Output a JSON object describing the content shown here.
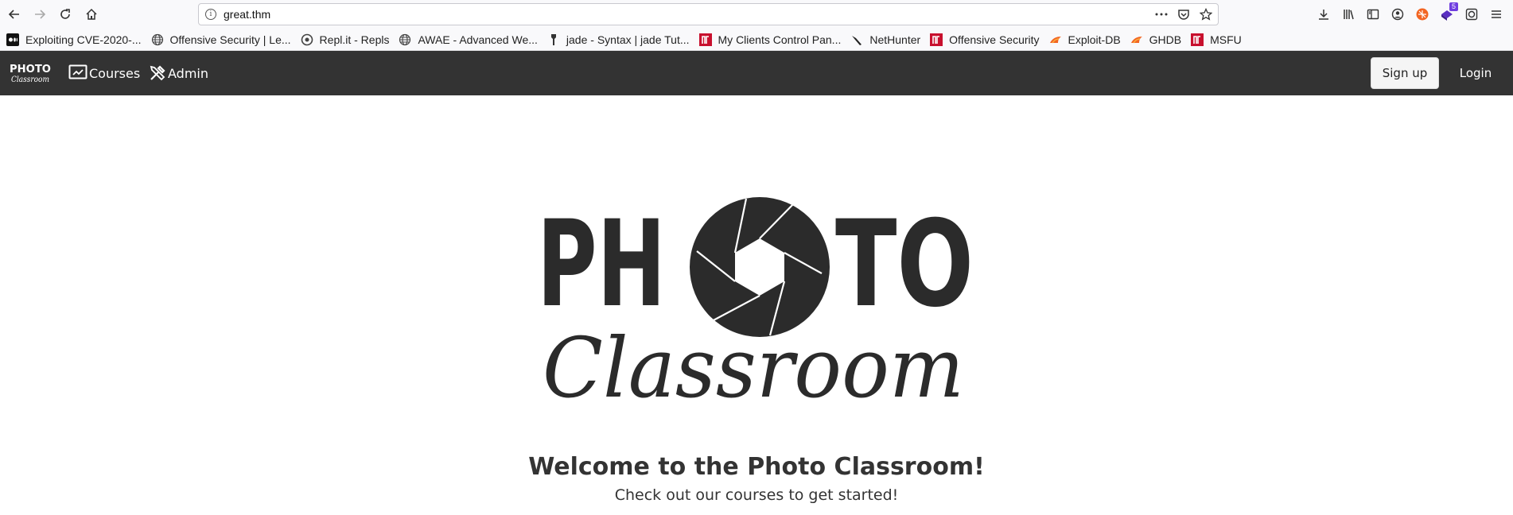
{
  "browser": {
    "url": "great.thm",
    "extension_badge": "5",
    "icons": [
      "back-icon",
      "forward-icon",
      "reload-icon",
      "home-icon",
      "info-icon",
      "more-icon",
      "pocket-icon",
      "bookmark-star-icon",
      "download-icon",
      "library-icon",
      "sidebar-icon",
      "account-icon",
      "extension-icon",
      "menu-icon"
    ]
  },
  "bookmarks": [
    {
      "label": "Exploiting CVE-2020-...",
      "icon": "medium-icon"
    },
    {
      "label": "Offensive Security | Le...",
      "icon": "globe-icon"
    },
    {
      "label": "Repl.it - Repls",
      "icon": "replit-icon"
    },
    {
      "label": "AWAE - Advanced We...",
      "icon": "globe-icon"
    },
    {
      "label": "jade - Syntax | jade Tut...",
      "icon": "jade-icon"
    },
    {
      "label": "My Clients Control Pan...",
      "icon": "offsec-icon"
    },
    {
      "label": "NetHunter",
      "icon": "nethunter-icon"
    },
    {
      "label": "Offensive Security",
      "icon": "offsec-icon"
    },
    {
      "label": "Exploit-DB",
      "icon": "exploitdb-icon"
    },
    {
      "label": "GHDB",
      "icon": "exploitdb-icon"
    },
    {
      "label": "MSFU",
      "icon": "offsec-icon"
    }
  ],
  "site_nav": {
    "brand_top": "PHOTO",
    "brand_bottom": "Classroom",
    "courses": "Courses",
    "admin": "Admin",
    "signup": "Sign up",
    "login": "Login"
  },
  "hero": {
    "logo_top": "PHOTO",
    "logo_bottom": "Classroom",
    "title": "Welcome to the Photo Classroom!",
    "subtitle": "Check out our courses to get started!"
  },
  "colors": {
    "navbar_bg": "#333333",
    "logo": "#2b2b2b",
    "text": "#333333"
  }
}
